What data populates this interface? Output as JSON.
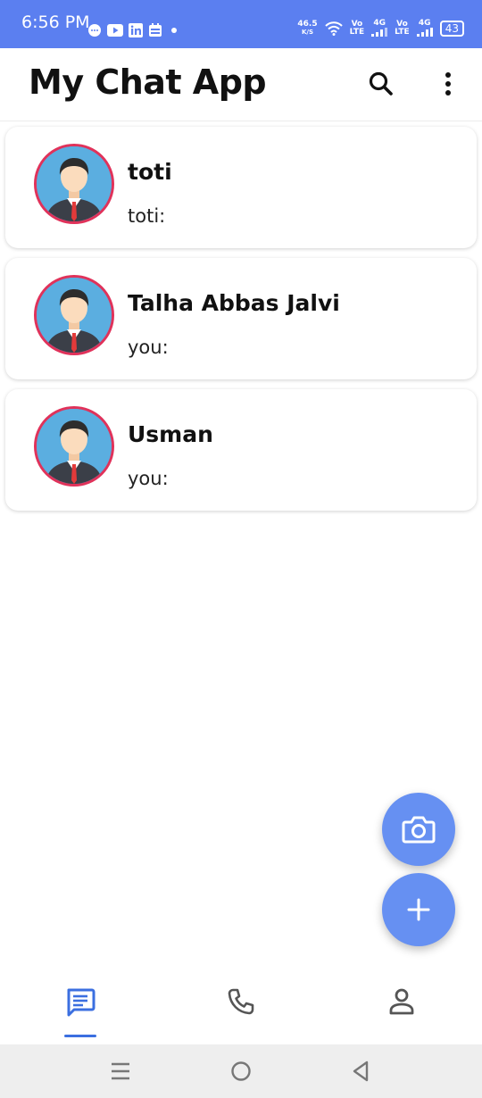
{
  "status_bar": {
    "time": "6:56 PM",
    "net_speed_value": "46.5",
    "net_speed_unit": "K/S",
    "sim1_top": "Vo",
    "sim1_bottom": "LTE",
    "sim1_gen": "4G",
    "sim2_top": "Vo",
    "sim2_bottom": "LTE",
    "sim2_gen": "4G",
    "battery": "43",
    "notification_icons": [
      "chat-bubble-icon",
      "youtube-icon",
      "linkedin-icon",
      "calendar-icon",
      "dot-icon"
    ]
  },
  "app_bar": {
    "title": "My Chat App",
    "search_icon": "search-icon",
    "more_icon": "more-vertical-icon"
  },
  "chats": [
    {
      "name": "toti",
      "last_message": "toti:"
    },
    {
      "name": "Talha Abbas Jalvi",
      "last_message": "you:"
    },
    {
      "name": "Usman",
      "last_message": "you:"
    }
  ],
  "fabs": {
    "camera_icon": "camera-icon",
    "add_icon": "plus-icon"
  },
  "bottom_nav": {
    "items": [
      "chats-icon",
      "phone-icon",
      "person-icon"
    ],
    "active_index": 0
  },
  "colors": {
    "primary": "#5b7ff0",
    "fab": "#6690f2",
    "avatar_ring": "#e0325a",
    "avatar_bg": "#5baee0",
    "nav_active": "#3b6fe0"
  }
}
